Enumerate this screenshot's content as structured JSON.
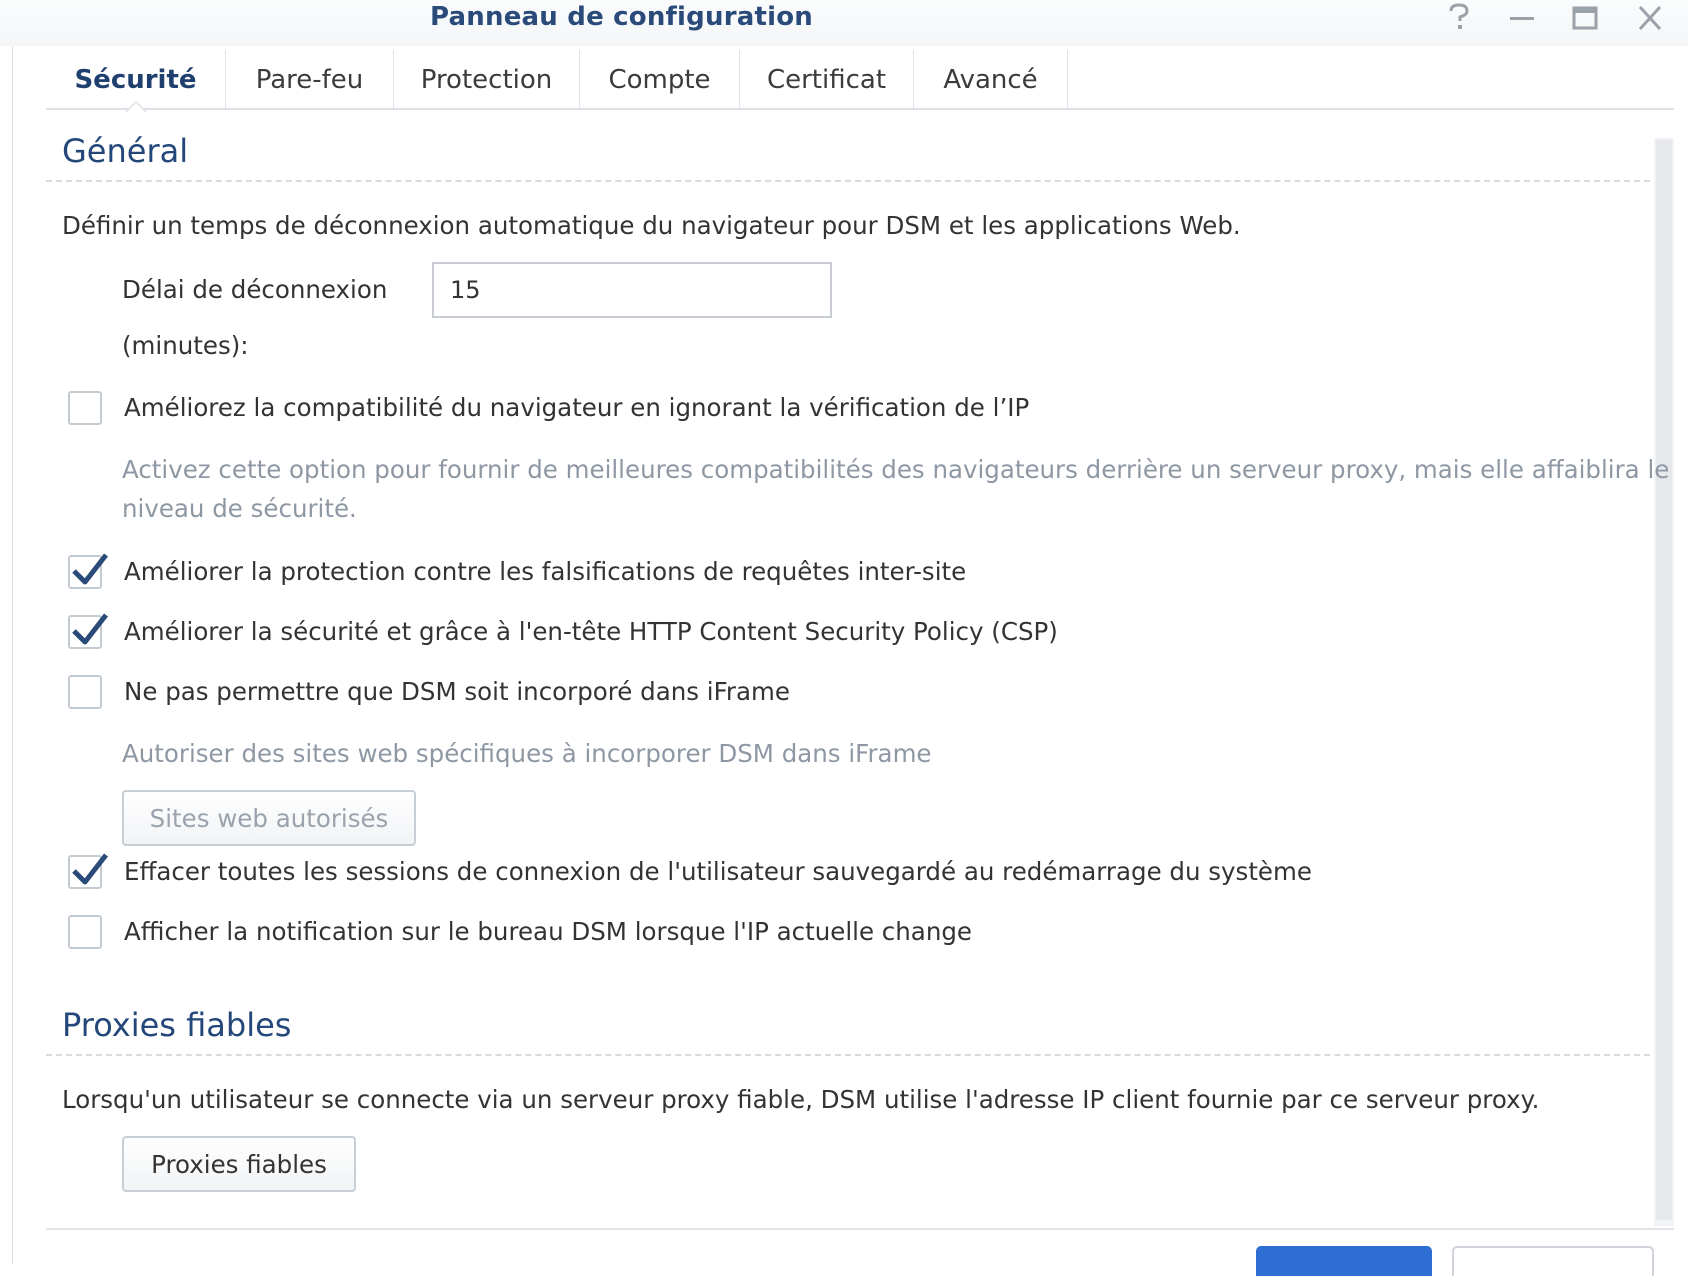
{
  "window": {
    "title": "Panneau de configuration",
    "controls": [
      "help-icon",
      "minimize-icon",
      "maximize-icon",
      "close-icon"
    ]
  },
  "tabs": [
    {
      "label": "Sécurité",
      "active": true
    },
    {
      "label": "Pare-feu",
      "active": false
    },
    {
      "label": "Protection",
      "active": false
    },
    {
      "label": "Compte",
      "active": false
    },
    {
      "label": "Certificat",
      "active": false
    },
    {
      "label": "Avancé",
      "active": false
    }
  ],
  "general": {
    "heading": "Général",
    "description": "Définir un temps de déconnexion automatique du navigateur pour DSM et les applications Web.",
    "timeout_label_line1": "Délai de déconnexion",
    "timeout_label_line2": "(minutes):",
    "timeout_value": "15",
    "options": [
      {
        "label": "Améliorez la compatibilité du navigateur en ignorant la vérification de l’IP",
        "checked": false
      },
      {
        "label": "Améliorer la protection contre les falsifications de requêtes inter-site",
        "checked": true
      },
      {
        "label": "Améliorer la sécurité et grâce à l'en-tête HTTP Content Security Policy (CSP)",
        "checked": true
      },
      {
        "label": "Ne pas permettre que DSM soit incorporé dans iFrame",
        "checked": false
      },
      {
        "label": "Effacer toutes les sessions de connexion de l'utilisateur sauvegardé au redémarrage du système",
        "checked": true
      },
      {
        "label": "Afficher la notification sur le bureau DSM lorsque l'IP actuelle change",
        "checked": false
      }
    ],
    "ip_hint_line1": "Activez cette option pour fournir de meilleures compatibilités des navigateurs derrière un serveur proxy, mais elle affaiblira le",
    "ip_hint_line2": "niveau de sécurité.",
    "iframe_hint": "Autoriser des sites web spécifiques à incorporer DSM dans iFrame",
    "allowed_sites_button": "Sites web autorisés"
  },
  "proxies": {
    "heading": "Proxies fiables",
    "description": "Lorsqu'un utilisateur se connecte via un serveur proxy fiable, DSM utilise l'adresse IP client fournie par ce serveur proxy.",
    "button": "Proxies fiables"
  },
  "colors": {
    "title": "#2a4a79",
    "heading": "#24477a",
    "checkmark": "#2a4a79",
    "primary_button": "#2e6dd2"
  }
}
